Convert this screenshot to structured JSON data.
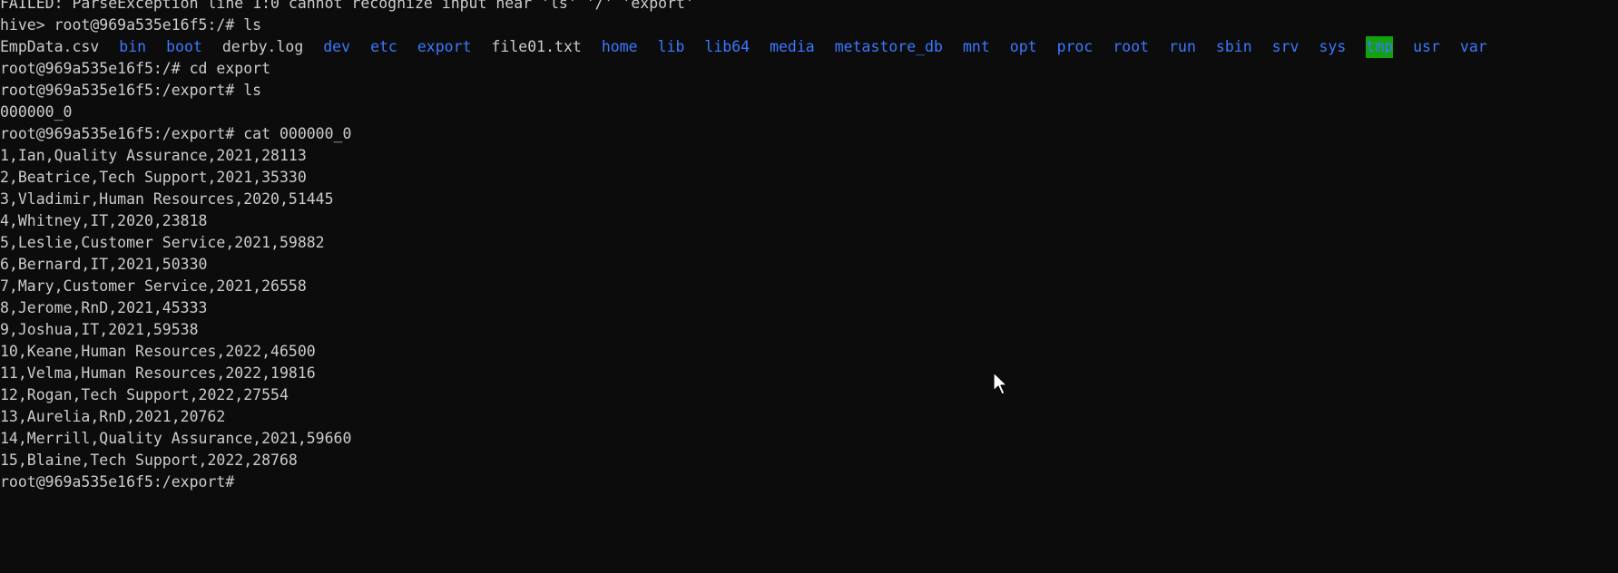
{
  "terminal": {
    "top_partial": "FAILED: ParseException line 1:0 cannot recognize input near 'ls' '/' 'export'",
    "lines": [
      "hive> root@969a535e16f5:/# ls",
      "LS_ROW",
      "root@969a535e16f5:/# cd export",
      "root@969a535e16f5:/export# ls",
      "000000_0",
      "root@969a535e16f5:/export# cat 000000_0",
      "1,Ian,Quality Assurance,2021,28113",
      "2,Beatrice,Tech Support,2021,35330",
      "3,Vladimir,Human Resources,2020,51445",
      "4,Whitney,IT,2020,23818",
      "5,Leslie,Customer Service,2021,59882",
      "6,Bernard,IT,2021,50330",
      "7,Mary,Customer Service,2021,26558",
      "8,Jerome,RnD,2021,45333",
      "9,Joshua,IT,2021,59538",
      "10,Keane,Human Resources,2022,46500",
      "11,Velma,Human Resources,2022,19816",
      "12,Rogan,Tech Support,2022,27554",
      "13,Aurelia,RnD,2021,20762",
      "14,Merrill,Quality Assurance,2021,59660",
      "15,Blaine,Tech Support,2022,28768",
      "root@969a535e16f5:/export#"
    ],
    "ls_items": [
      {
        "name": "EmpData.csv",
        "kind": "file"
      },
      {
        "name": "bin",
        "kind": "dir"
      },
      {
        "name": "boot",
        "kind": "dir"
      },
      {
        "name": "derby.log",
        "kind": "file"
      },
      {
        "name": "dev",
        "kind": "dir"
      },
      {
        "name": "etc",
        "kind": "dir"
      },
      {
        "name": "export",
        "kind": "dir"
      },
      {
        "name": "file01.txt",
        "kind": "file"
      },
      {
        "name": "home",
        "kind": "dir"
      },
      {
        "name": "lib",
        "kind": "dir"
      },
      {
        "name": "lib64",
        "kind": "dir"
      },
      {
        "name": "media",
        "kind": "dir"
      },
      {
        "name": "metastore_db",
        "kind": "dir"
      },
      {
        "name": "mnt",
        "kind": "dir"
      },
      {
        "name": "opt",
        "kind": "dir"
      },
      {
        "name": "proc",
        "kind": "dir"
      },
      {
        "name": "root",
        "kind": "dir"
      },
      {
        "name": "run",
        "kind": "dir"
      },
      {
        "name": "sbin",
        "kind": "dir"
      },
      {
        "name": "srv",
        "kind": "dir"
      },
      {
        "name": "sys",
        "kind": "dir"
      },
      {
        "name": "tmp",
        "kind": "hl"
      },
      {
        "name": "usr",
        "kind": "dir"
      },
      {
        "name": "var",
        "kind": "dir"
      }
    ],
    "colors": {
      "background": "#0c0c0c",
      "foreground": "#cccccc",
      "directory": "#3b78ff",
      "sticky_dir_bg": "#13a10e"
    }
  },
  "cursor": {
    "icon": "mouse-pointer-icon"
  }
}
